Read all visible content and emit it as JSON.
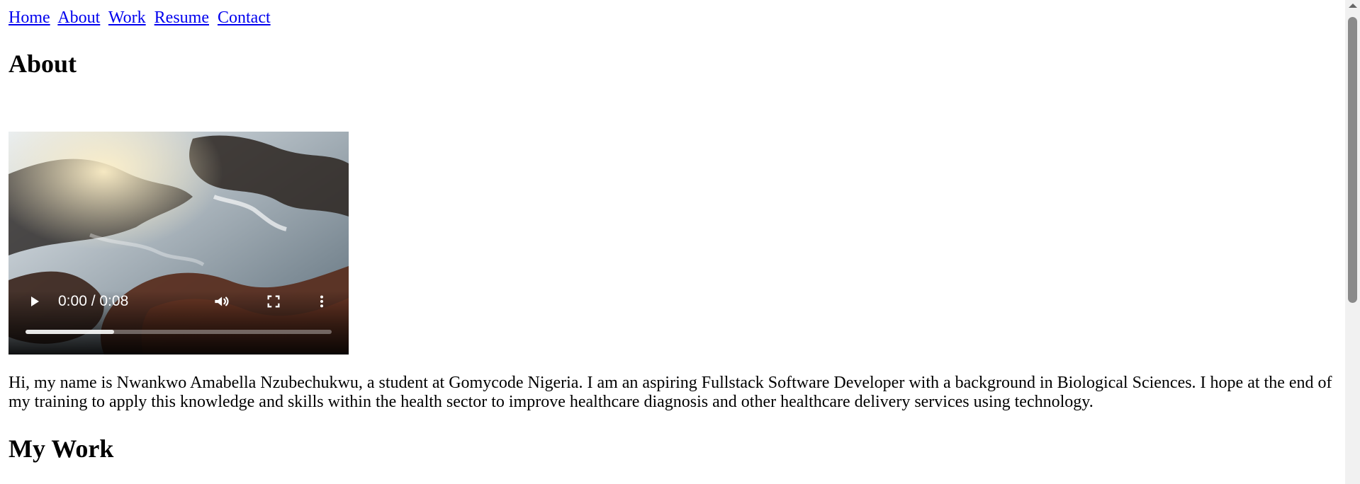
{
  "nav": {
    "items": [
      {
        "label": "Home"
      },
      {
        "label": "About"
      },
      {
        "label": "Work"
      },
      {
        "label": "Resume"
      },
      {
        "label": "Contact"
      }
    ]
  },
  "about": {
    "heading": "About",
    "paragraph": "Hi, my name is Nwankwo Amabella Nzubechukwu, a student at Gomycode Nigeria. I am an aspiring Fullstack Software Developer with a background in Biological Sciences. I hope at the end of my training to apply this knowledge and skills within the health sector to improve healthcare diagnosis and other healthcare delivery services using technology."
  },
  "video": {
    "time_display": "0:00 / 0:08",
    "progress_buffered_fraction": 0.29,
    "icons": {
      "play": "play-icon",
      "volume": "volume-icon",
      "fullscreen": "fullscreen-icon",
      "more": "more-options-icon"
    }
  },
  "work": {
    "heading": "My Work"
  },
  "colors": {
    "link": "#0000EE",
    "text": "#000000",
    "scrollbar_track": "#f1f1f1",
    "scrollbar_thumb": "#8a8a8a"
  }
}
